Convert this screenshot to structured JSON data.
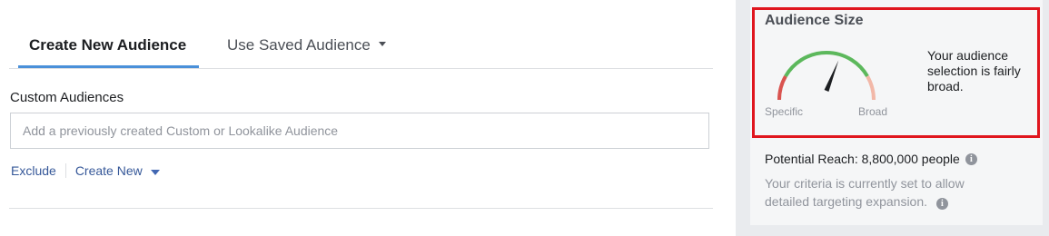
{
  "tabs": {
    "create_new": "Create New Audience",
    "use_saved": "Use Saved Audience"
  },
  "custom_audiences": {
    "label": "Custom Audiences",
    "placeholder": "Add a previously created Custom or Lookalike Audience",
    "exclude_link": "Exclude",
    "create_new_link": "Create New"
  },
  "audience_size": {
    "title": "Audience Size",
    "gauge_low_label": "Specific",
    "gauge_high_label": "Broad",
    "gauge_level": 0.62,
    "description": "Your audience selection is fairly broad.",
    "colors": {
      "specific": "#d9534f",
      "ideal": "#5cb85c",
      "broad": "#f2b8a8",
      "needle": "#1c1e21"
    }
  },
  "potential_reach": {
    "label": "Potential Reach: 8,800,000 people",
    "info_icon": "i"
  },
  "criteria": {
    "text": "Your criteria is currently set to allow detailed targeting expansion.",
    "info_icon": "i"
  },
  "colors": {
    "highlight_border": "#e0161e",
    "link": "#365899",
    "tab_underline": "#4a90d9"
  }
}
